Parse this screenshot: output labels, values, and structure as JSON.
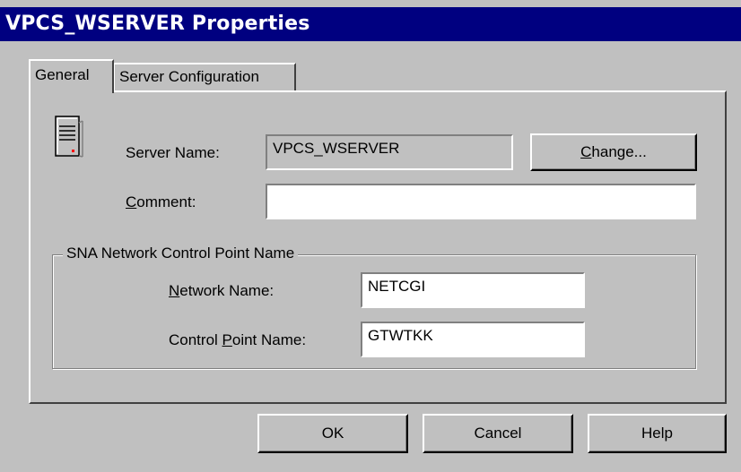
{
  "window": {
    "title": "VPCS_WSERVER Properties"
  },
  "tabs": [
    {
      "label": "General",
      "active": true
    },
    {
      "label": "Server Configuration",
      "active": false
    }
  ],
  "general": {
    "server_icon": "server-icon",
    "server_name_label": "Server Name:",
    "server_name_value": "VPCS_WSERVER",
    "change_button": {
      "underlined": "C",
      "rest": "hange..."
    },
    "comment_label": {
      "underlined": "C",
      "rest": "omment:"
    },
    "comment_value": "",
    "sna_group": {
      "title": "SNA Network Control Point Name",
      "network_name_label": {
        "underlined": "N",
        "rest": "etwork Name:"
      },
      "network_name_value": "NETCGI",
      "control_point_label": {
        "before": "Control ",
        "underlined": "P",
        "rest": "oint Name:"
      },
      "control_point_value": "GTWTKK"
    }
  },
  "buttons": {
    "ok": "OK",
    "cancel": "Cancel",
    "help": "Help"
  },
  "colors": {
    "titlebar": "#000080",
    "face": "#c0c0c0",
    "highlight": "#ffffff",
    "shadow": "#808080"
  }
}
